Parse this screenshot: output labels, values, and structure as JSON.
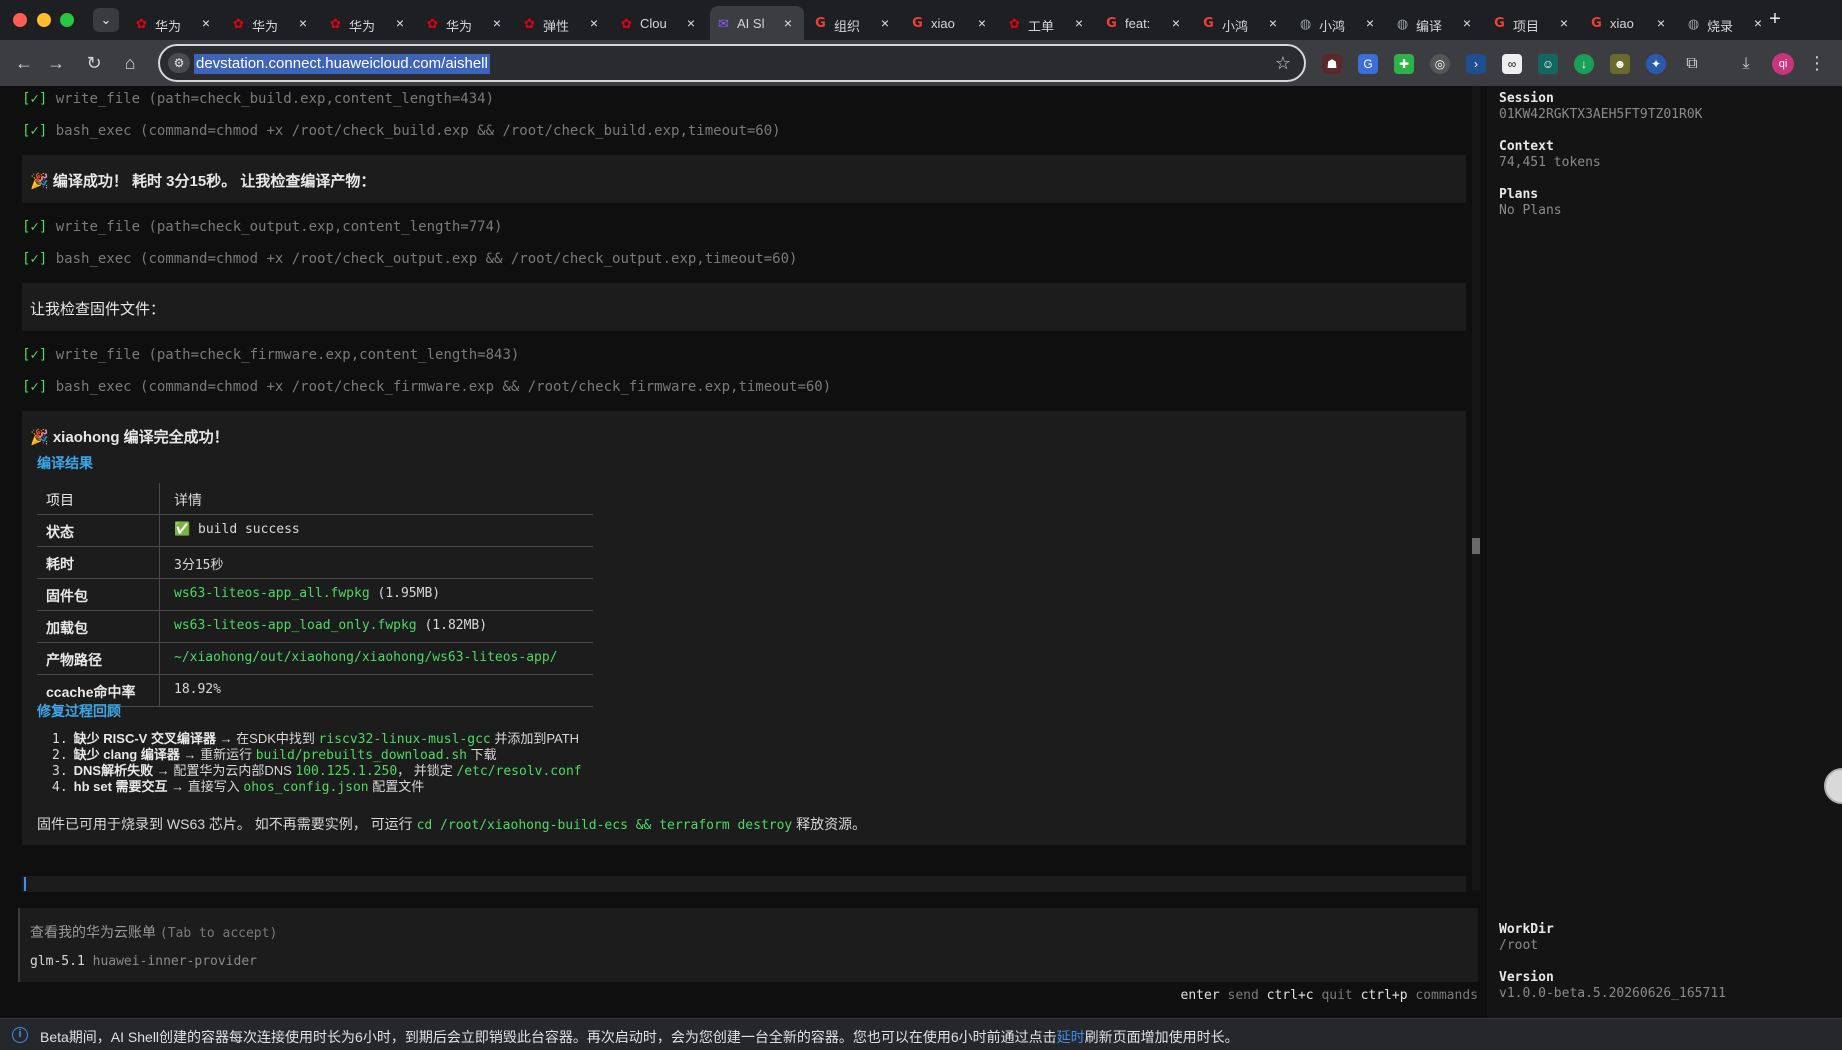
{
  "browser": {
    "tabs": [
      {
        "icon": "huawei-icon",
        "glyph": "✿",
        "cls": "huawei",
        "label": "华为"
      },
      {
        "icon": "huawei-icon",
        "glyph": "✿",
        "cls": "huawei",
        "label": "华为"
      },
      {
        "icon": "huawei-icon",
        "glyph": "✿",
        "cls": "huawei",
        "label": "华为"
      },
      {
        "icon": "huawei-icon",
        "glyph": "✿",
        "cls": "huawei",
        "label": "华为"
      },
      {
        "icon": "huawei-icon",
        "glyph": "✿",
        "cls": "huawei",
        "label": "弹性"
      },
      {
        "icon": "huawei-icon",
        "glyph": "✿",
        "cls": "huawei",
        "label": "Clou"
      },
      {
        "icon": "aishell-icon",
        "glyph": "✉",
        "cls": "aishell",
        "label": "AI Sl"
      },
      {
        "icon": "google-icon",
        "glyph": "G",
        "cls": "google",
        "label": "组织"
      },
      {
        "icon": "google-icon",
        "glyph": "G",
        "cls": "google",
        "label": "xiao"
      },
      {
        "icon": "huawei-icon",
        "glyph": "✿",
        "cls": "huawei",
        "label": "工单"
      },
      {
        "icon": "google-icon",
        "glyph": "G",
        "cls": "google",
        "label": "feat:"
      },
      {
        "icon": "google-icon",
        "glyph": "G",
        "cls": "google",
        "label": "小鸿"
      },
      {
        "icon": "globe-icon",
        "glyph": "◍",
        "cls": "globe",
        "label": "小鸿"
      },
      {
        "icon": "globe-icon",
        "glyph": "◍",
        "cls": "globe",
        "label": "编译"
      },
      {
        "icon": "google-icon",
        "glyph": "G",
        "cls": "google",
        "label": "项目"
      },
      {
        "icon": "google-icon",
        "glyph": "G",
        "cls": "google",
        "label": "xiao"
      },
      {
        "icon": "globe-icon",
        "glyph": "◍",
        "cls": "globe",
        "label": "烧录"
      }
    ],
    "active_tab": 6,
    "url": "devstation.connect.huaweicloud.com/aishell"
  },
  "log": {
    "lines": [
      {
        "check": "[✓]",
        "text": " write_file (path=check_build.exp,content_length=434)"
      },
      {
        "check": "[✓]",
        "text": " bash_exec (command=chmod +x /root/check_build.exp && /root/check_build.exp,timeout=60)"
      },
      {
        "check": "[✓]",
        "text": " write_file (path=check_output.exp,content_length=774)"
      },
      {
        "check": "[✓]",
        "text": " bash_exec (command=chmod +x /root/check_output.exp && /root/check_output.exp,timeout=60)"
      },
      {
        "check": "[✓]",
        "text": " write_file (path=check_firmware.exp,content_length=843)"
      },
      {
        "check": "[✓]",
        "text": " bash_exec (command=chmod +x /root/check_firmware.exp && /root/check_firmware.exp,timeout=60)"
      }
    ],
    "msg1": "🎉 编译成功！ 耗时 3分15秒。 让我检查编译产物：",
    "msg2": "让我检查固件文件：",
    "final_title": "🎉 xiaohong 编译完全成功！",
    "result_heading": "编译结果",
    "table_header": {
      "key": "项目",
      "value": "详情"
    },
    "table_rows": [
      {
        "key": "状态",
        "value": "✅ build success",
        "green": false
      },
      {
        "key": "耗时",
        "value": "3分15秒",
        "green": false
      },
      {
        "key": "固件包",
        "value": "ws63-liteos-app_all.fwpkg",
        "suffix": " (1.95MB)",
        "green": true
      },
      {
        "key": "加载包",
        "value": "ws63-liteos-app_load_only.fwpkg",
        "suffix": " (1.82MB)",
        "green": true
      },
      {
        "key": "产物路径",
        "value": "~/xiaohong/out/xiaohong/xiaohong/ws63-liteos-app/",
        "green": true
      },
      {
        "key": "ccache命中率",
        "value": "18.92%",
        "green": false
      }
    ],
    "fix_heading": "修复过程回顾",
    "fixes": [
      {
        "n": "1.",
        "bold": "缺少 RISC-V 交叉编译器",
        "mid": " → 在SDK中找到 ",
        "code": "riscv32-linux-musl-gcc",
        "tail": " 并添加到PATH"
      },
      {
        "n": "2.",
        "bold": "缺少 clang 编译器",
        "mid": " → 重新运行 ",
        "code": "build/prebuilts_download.sh",
        "tail": " 下载"
      },
      {
        "n": "3.",
        "bold": "DNS解析失败",
        "mid": " → 配置华为云内部DNS ",
        "code": "100.125.1.250",
        "tail": "， 并锁定 ",
        "code2": "/etc/resolv.conf"
      },
      {
        "n": "4.",
        "bold": "hb set 需要交互",
        "mid": " → 直接写入 ",
        "code": "ohos_config.json",
        "tail": " 配置文件"
      }
    ],
    "finale_pre": "固件已可用于烧录到 WS63 芯片。 如不再需要实例， 可运行 ",
    "finale_code": "cd /root/xiaohong-build-ecs && terraform destroy",
    "finale_post": " 释放资源。"
  },
  "prompt": {
    "suggestion": "查看我的华为云账单",
    "hint": "(Tab to accept)",
    "model": "glm-5.1",
    "provider": "huawei-inner-provider"
  },
  "shortcuts": [
    {
      "key": "enter",
      "label": "send"
    },
    {
      "key": "ctrl+c",
      "label": "quit"
    },
    {
      "key": "ctrl+p",
      "label": "commands"
    }
  ],
  "sidebar": {
    "session_label": "Session",
    "session_id": "01KW42RGKTX3AEH5FT9TZ01R0K",
    "context_label": "Context",
    "context_value": "74,451 tokens",
    "plans_label": "Plans",
    "plans_value": "No Plans",
    "workdir_label": "WorkDir",
    "workdir_value": "/root",
    "version_label": "Version",
    "version_value": "v1.0.0-beta.5.20260626_165711"
  },
  "notice": {
    "text": "Beta期间，AI Shell创建的容器每次连接使用时长为6小时，到期后会立即销毁此台容器。再次启动时，会为您创建一台全新的容器。您也可以在使用6小时前通过点击",
    "link": "延时",
    "tail": "刷新页面增加使用时长。"
  },
  "colors": {
    "accent": "#39a7e8",
    "success": "#4cd964",
    "link": "#3d8ef0"
  }
}
